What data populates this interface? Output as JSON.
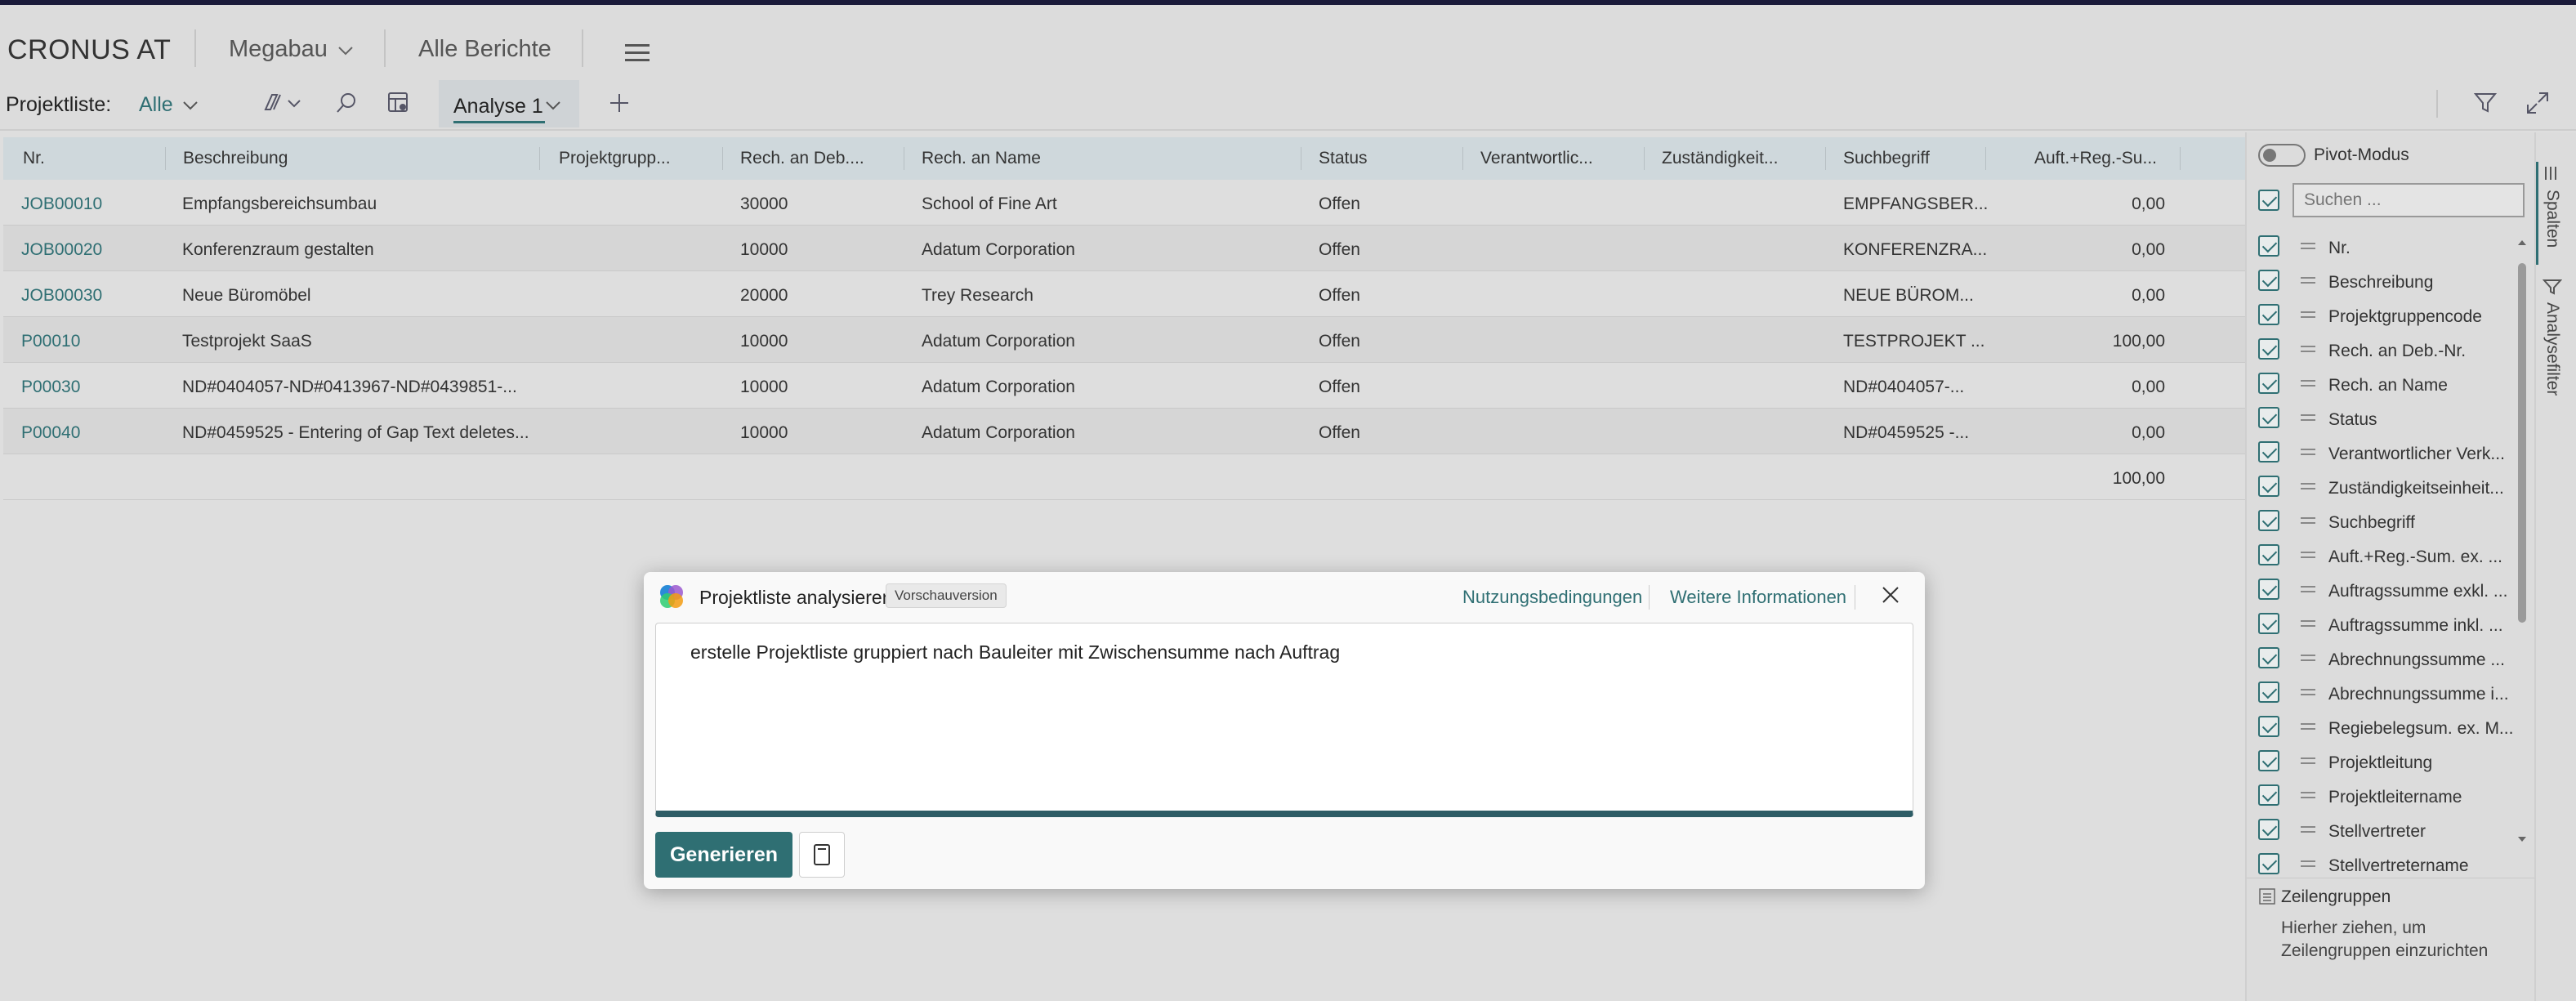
{
  "header": {
    "company": "CRONUS AT",
    "role_center": "Megabau",
    "reports": "Alle Berichte"
  },
  "actionbar": {
    "list_label": "Projektliste:",
    "filter_value": "Alle",
    "active_tab": "Analyse 1"
  },
  "grid": {
    "columns": [
      "Nr.",
      "Beschreibung",
      "Projektgrupp...",
      "Rech. an Deb....",
      "Rech. an Name",
      "Status",
      "Verantwortlic...",
      "Zuständigkeit...",
      "Suchbegriff",
      "Auft.+Reg.-Su..."
    ],
    "rows": [
      {
        "nr": "JOB00010",
        "beschreibung": "Empfangsbereichsumbau",
        "gruppe": "",
        "deb": "30000",
        "name": "School of Fine Art",
        "status": "Offen",
        "verantw": "",
        "zust": "",
        "such": "EMPFANGSBER...",
        "summe": "0,00"
      },
      {
        "nr": "JOB00020",
        "beschreibung": "Konferenzraum gestalten",
        "gruppe": "",
        "deb": "10000",
        "name": "Adatum Corporation",
        "status": "Offen",
        "verantw": "",
        "zust": "",
        "such": "KONFERENZRA...",
        "summe": "0,00"
      },
      {
        "nr": "JOB00030",
        "beschreibung": "Neue Büromöbel",
        "gruppe": "",
        "deb": "20000",
        "name": "Trey Research",
        "status": "Offen",
        "verantw": "",
        "zust": "",
        "such": "NEUE BÜROM...",
        "summe": "0,00"
      },
      {
        "nr": "P00010",
        "beschreibung": "Testprojekt SaaS",
        "gruppe": "",
        "deb": "10000",
        "name": "Adatum Corporation",
        "status": "Offen",
        "verantw": "",
        "zust": "",
        "such": "TESTPROJEKT ...",
        "summe": "100,00"
      },
      {
        "nr": "P00030",
        "beschreibung": "ND#0404057-ND#0413967-ND#0439851-...",
        "gruppe": "",
        "deb": "10000",
        "name": "Adatum Corporation",
        "status": "Offen",
        "verantw": "",
        "zust": "",
        "such": "ND#0404057-...",
        "summe": "0,00"
      },
      {
        "nr": "P00040",
        "beschreibung": "ND#0459525 - Entering of Gap Text deletes...",
        "gruppe": "",
        "deb": "10000",
        "name": "Adatum Corporation",
        "status": "Offen",
        "verantw": "",
        "zust": "",
        "such": "ND#0459525 -...",
        "summe": "0,00"
      }
    ],
    "total": "100,00"
  },
  "panel": {
    "pivot_label": "Pivot-Modus",
    "search_placeholder": "Suchen ...",
    "tab_columns": "Spalten",
    "tab_filters": "Analysefilter",
    "columns": [
      "Nr.",
      "Beschreibung",
      "Projektgruppencode",
      "Rech. an Deb.-Nr.",
      "Rech. an Name",
      "Status",
      "Verantwortlicher Verk...",
      "Zuständigkeitseinheit...",
      "Suchbegriff",
      "Auft.+Reg.-Sum. ex. ...",
      "Auftragssumme exkl. ...",
      "Auftragssumme inkl. ...",
      "Abrechnungssumme ...",
      "Abrechnungssumme i...",
      "Regiebelegsum. ex. M...",
      "Projektleitung",
      "Projektleitername",
      "Stellvertreter",
      "Stellvertretername"
    ],
    "row_groups_title": "Zeilengruppen",
    "row_groups_hint": "Hierher ziehen, um Zeilengruppen einzurichten"
  },
  "dialog": {
    "title": "Projektliste analysieren",
    "badge": "Vorschauversion",
    "terms_link": "Nutzungsbedingungen",
    "info_link": "Weitere Informationen",
    "prompt_text": "erstelle Projektliste gruppiert nach Bauleiter mit Zwischensumme nach Auftrag",
    "generate_label": "Generieren"
  },
  "colors": {
    "accent": "#2f6f73",
    "header_bg": "#cfd8dc"
  }
}
